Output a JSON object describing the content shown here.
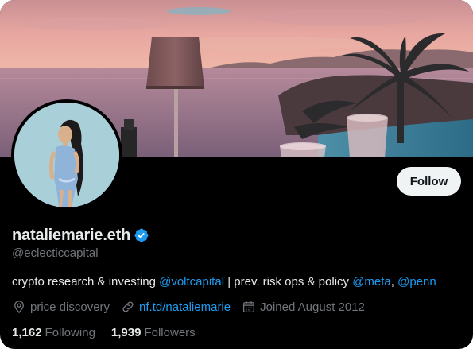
{
  "profile": {
    "display_name": "nataliemarie.eth",
    "handle": "@eclecticcapital",
    "bio": {
      "part1": "crypto research & investing ",
      "mention1": "@voltcapital",
      "part2": " | prev. risk ops & policy ",
      "mention2": "@meta",
      "part3": ", ",
      "mention3": "@penn"
    },
    "location": "price discovery",
    "website": "nf.td/nataliemarie",
    "joined": "Joined August 2012",
    "following_count": "1,162",
    "following_label": "Following",
    "followers_count": "1,939",
    "followers_label": "Followers"
  },
  "actions": {
    "follow_label": "Follow"
  },
  "icons": {
    "verified": "verified-badge-icon",
    "location": "location-pin-icon",
    "website": "link-icon",
    "joined": "calendar-icon"
  },
  "colors": {
    "background": "#000000",
    "primary_text": "#e7e9ea",
    "secondary_text": "#71767b",
    "link": "#1d9bf0",
    "verified_badge": "#1d9bf0",
    "follow_button_bg": "#eff3f4",
    "follow_button_text": "#0f1419"
  }
}
